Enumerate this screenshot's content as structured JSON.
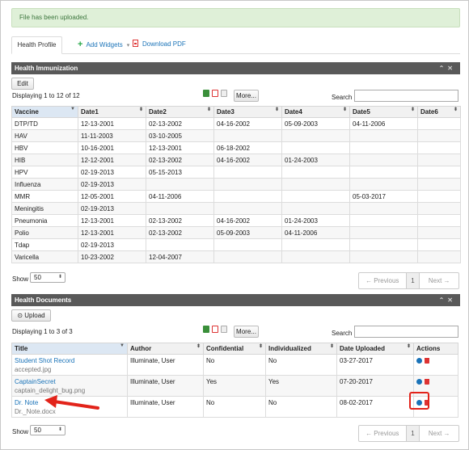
{
  "alert": {
    "message": "File has been uploaded."
  },
  "tabs": [
    {
      "label": "Health Profile"
    },
    {
      "label": "Add Widgets"
    },
    {
      "label": "Download PDF"
    }
  ],
  "immunization": {
    "title": "Health Immunization",
    "edit_label": "Edit",
    "displaying": "Displaying 1 to 12 of 12",
    "more_label": "More...",
    "search_label": "Search",
    "search_value": "",
    "columns": [
      "Vaccine",
      "Date1",
      "Date2",
      "Date3",
      "Date4",
      "Date5",
      "Date6"
    ],
    "rows": [
      [
        "DTP/TD",
        "12-13-2001",
        "02-13-2002",
        "04-16-2002",
        "05-09-2003",
        "04-11-2006",
        ""
      ],
      [
        "HAV",
        "11-11-2003",
        "03-10-2005",
        "",
        "",
        "",
        ""
      ],
      [
        "HBV",
        "10-16-2001",
        "12-13-2001",
        "06-18-2002",
        "",
        "",
        ""
      ],
      [
        "HIB",
        "12-12-2001",
        "02-13-2002",
        "04-16-2002",
        "01-24-2003",
        "",
        ""
      ],
      [
        "HPV",
        "02-19-2013",
        "05-15-2013",
        "",
        "",
        "",
        ""
      ],
      [
        "Influenza",
        "02-19-2013",
        "",
        "",
        "",
        "",
        ""
      ],
      [
        "MMR",
        "12-05-2001",
        "04-11-2006",
        "",
        "",
        "05-03-2017",
        ""
      ],
      [
        "Meningitis",
        "02-19-2013",
        "",
        "",
        "",
        "",
        ""
      ],
      [
        "Pneumonia",
        "12-13-2001",
        "02-13-2002",
        "04-16-2002",
        "01-24-2003",
        "",
        ""
      ],
      [
        "Polio",
        "12-13-2001",
        "02-13-2002",
        "05-09-2003",
        "04-11-2006",
        "",
        ""
      ],
      [
        "Tdap",
        "02-19-2013",
        "",
        "",
        "",
        "",
        ""
      ],
      [
        "Varicella",
        "10-23-2002",
        "12-04-2007",
        "",
        "",
        "",
        ""
      ]
    ],
    "show_label": "Show",
    "show_value": "50",
    "prev_label": "← Previous",
    "page_label": "1",
    "next_label": "Next →"
  },
  "documents": {
    "title": "Health Documents",
    "upload_label": "Upload",
    "displaying": "Displaying 1 to 3 of 3",
    "more_label": "More...",
    "search_label": "Search",
    "search_value": "",
    "columns": [
      "Title",
      "Author",
      "Confidential",
      "Individualized",
      "Date Uploaded",
      "Actions"
    ],
    "rows": [
      {
        "title": "Student Shot Record",
        "file": "accepted.jpg",
        "author": "Illuminate, User",
        "confidential": "No",
        "individualized": "No",
        "date": "03-27-2017"
      },
      {
        "title": "CaptainSecret",
        "file": "captain_delight_bug.png",
        "author": "Illuminate, User",
        "confidential": "Yes",
        "individualized": "Yes",
        "date": "07-20-2017"
      },
      {
        "title": "Dr. Note",
        "file": "Dr._Note.docx",
        "author": "Illuminate, User",
        "confidential": "No",
        "individualized": "No",
        "date": "08-02-2017"
      }
    ],
    "show_label": "Show",
    "show_value": "50",
    "prev_label": "← Previous",
    "page_label": "1",
    "next_label": "Next →"
  },
  "colors": {
    "accent": "#1a73b8",
    "header_bg": "#595959",
    "alert_bg": "#dff0d8",
    "annotation": "#e2231a"
  }
}
